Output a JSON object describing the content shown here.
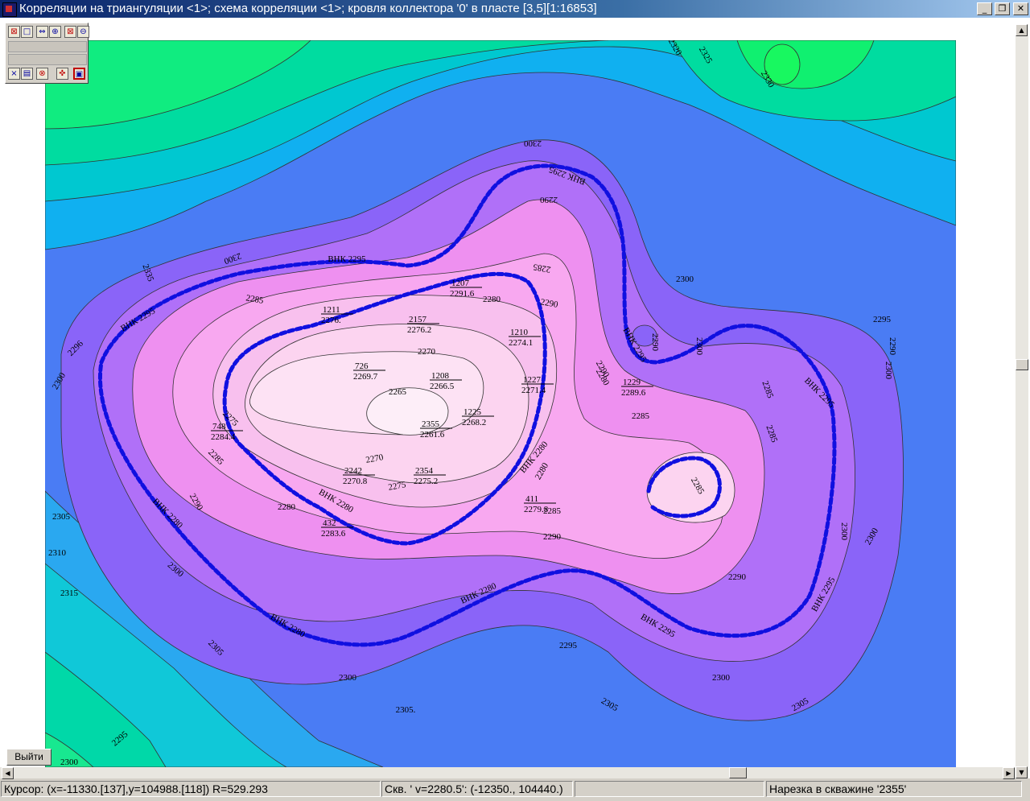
{
  "window": {
    "title": "Корреляции на триангуляции <1>; схема корреляции <1>; кровля коллектора '0' в пласте [3,5][1:16853]",
    "minimize_glyph": "_",
    "restore_glyph": "❐",
    "close_glyph": "✕"
  },
  "toolbox": {
    "row1": [
      "⊠",
      "□",
      "⇔",
      "⊕",
      "⊠",
      "⊖"
    ],
    "row3": [
      "×",
      "▤",
      "⊗",
      "✜",
      "▣"
    ]
  },
  "exit_button": "Выйти",
  "map": {
    "contour_labels": [
      {
        "text": "2300"
      },
      {
        "text": "2290"
      },
      {
        "text": "2300"
      },
      {
        "text": "2285"
      },
      {
        "text": "2300"
      },
      {
        "text": "2290"
      },
      {
        "text": "2300"
      },
      {
        "text": "2296"
      },
      {
        "text": "2285"
      },
      {
        "text": "2280"
      },
      {
        "text": "2270"
      },
      {
        "text": "2265"
      },
      {
        "text": "2275"
      },
      {
        "text": "2285"
      },
      {
        "text": "2290"
      },
      {
        "text": "2280"
      },
      {
        "text": "2275"
      },
      {
        "text": "2270"
      },
      {
        "text": "2280"
      },
      {
        "text": "2285"
      },
      {
        "text": "2290"
      },
      {
        "text": "2295"
      },
      {
        "text": "2300"
      },
      {
        "text": "2305"
      },
      {
        "text": "2310"
      },
      {
        "text": "2315"
      },
      {
        "text": "2305"
      },
      {
        "text": "2300"
      },
      {
        "text": "2305."
      },
      {
        "text": "2300"
      },
      {
        "text": "2305"
      },
      {
        "text": "2305"
      },
      {
        "text": "2300"
      },
      {
        "text": "2290"
      },
      {
        "text": "2285"
      },
      {
        "text": "2280"
      },
      {
        "text": "2285"
      },
      {
        "text": "2290"
      },
      {
        "text": "2300"
      },
      {
        "text": "2290"
      },
      {
        "text": "2285"
      },
      {
        "text": "2300"
      },
      {
        "text": "2295"
      },
      {
        "text": "2320"
      },
      {
        "text": "2325"
      },
      {
        "text": "2330"
      },
      {
        "text": "2335"
      },
      {
        "text": "2300"
      },
      {
        "text": "2290"
      },
      {
        "text": "2285"
      },
      {
        "text": "2300"
      },
      {
        "text": "2295"
      }
    ],
    "owc_labels": [
      "ВНК 2295",
      "ВНК 2295",
      "ВНК 2295",
      "ВНК 2295",
      "ВНК 2295",
      "ВНК 2295",
      "ВНК 2295",
      "ВНК 2280",
      "ВНК 2280",
      "ВНК 2280",
      "ВНК 2280",
      "ВНК 2280"
    ],
    "wells": [
      {
        "name": "1207",
        "value": "2291.6"
      },
      {
        "name": "1211",
        "value": "2276."
      },
      {
        "name": "2157",
        "value": "2276.2"
      },
      {
        "name": "1210",
        "value": "2274.1"
      },
      {
        "name": "726",
        "value": "2269.7"
      },
      {
        "name": "1208",
        "value": "2266.5"
      },
      {
        "name": "1227",
        "value": "2271.4"
      },
      {
        "name": "1229",
        "value": "2289.6"
      },
      {
        "name": "1225",
        "value": "2268.2"
      },
      {
        "name": "2355",
        "value": "2261.6"
      },
      {
        "name": "748",
        "value": "2284.4"
      },
      {
        "name": "2242",
        "value": "2270.8"
      },
      {
        "name": "2354",
        "value": "2275.2"
      },
      {
        "name": "411",
        "value": "2279.8"
      },
      {
        "name": "432",
        "value": "2283.6"
      }
    ]
  },
  "status": {
    "cursor": "Курсор: (x=-11330.[137],y=104988.[118]) R=529.293",
    "well": "Скв. ' v=2280.5': (-12350., 104440.)",
    "empty": "",
    "cut": "Нарезка в скважине '2355'"
  }
}
